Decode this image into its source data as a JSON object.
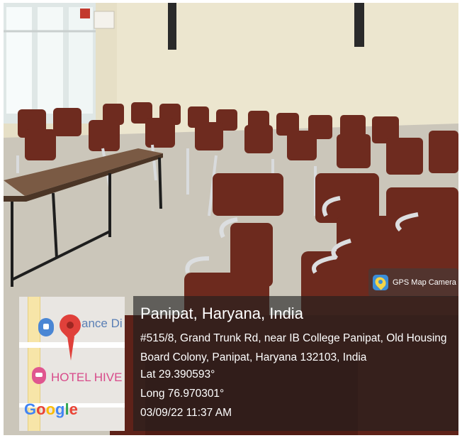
{
  "badge": {
    "icon": "gps-map-camera-icon",
    "label": "GPS Map Camera"
  },
  "map": {
    "area_label": "ance Di",
    "hotel_label": "HOTEL HIVE",
    "brand": "Google",
    "icons": [
      "location-pin-icon",
      "shopping-pin-icon",
      "hotel-pin-icon"
    ]
  },
  "info": {
    "place": "Panipat, Haryana, India",
    "address": "#515/8, Grand Trunk Rd, near IB College Panipat, Old Housing Board Colony, Panipat, Haryana 132103, India",
    "lat": "Lat 29.390593°",
    "long": "Long 76.970301°",
    "datetime": "03/09/22 11:37 AM"
  },
  "colors": {
    "wall": "#e8e1c8",
    "floor": "#c9c4b8",
    "chair_shell": "#6b2a1e",
    "table_top": "#7a5a44"
  }
}
